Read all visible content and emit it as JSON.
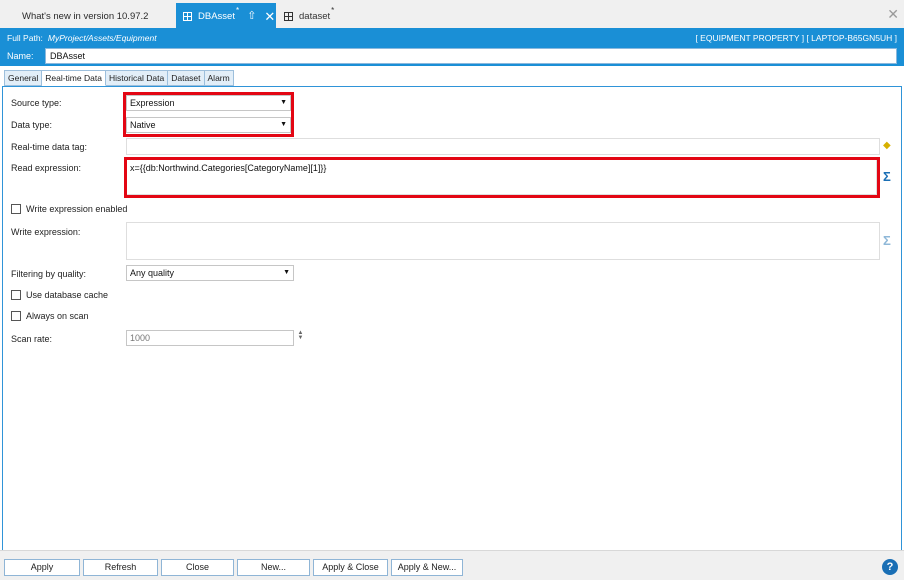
{
  "doc_tabs": [
    {
      "label": "What's new in version 10.97.2",
      "modified": ""
    },
    {
      "label": "DBAsset",
      "modified": "*"
    },
    {
      "label": "dataset",
      "modified": "*"
    }
  ],
  "header": {
    "path_label": "Full Path:",
    "path_value": "MyProject/Assets/Equipment",
    "path_right": "[ EQUIPMENT PROPERTY ] [ LAPTOP-B65GN5UH ]",
    "name_label": "Name:",
    "name_value": "DBAsset"
  },
  "property_tabs": [
    "General",
    "Real-time Data",
    "Historical Data",
    "Dataset",
    "Alarm"
  ],
  "form": {
    "source_type_label": "Source type:",
    "source_type_value": "Expression",
    "data_type_label": "Data type:",
    "data_type_value": "Native",
    "realtime_tag_label": "Real-time data tag:",
    "realtime_tag_value": "",
    "read_expression_label": "Read expression:",
    "read_expression_value": "x={{db:Northwind.Categories[CategoryName][1]}}",
    "write_enabled_label": "Write expression enabled",
    "write_expression_label": "Write expression:",
    "write_expression_value": "",
    "filtering_label": "Filtering by quality:",
    "filtering_value": "Any quality",
    "use_cache_label": "Use database cache",
    "always_scan_label": "Always on scan",
    "scan_rate_label": "Scan rate:",
    "scan_rate_value": "1000"
  },
  "buttons": {
    "apply": "Apply",
    "refresh": "Refresh",
    "close": "Close",
    "new": "New...",
    "apply_close": "Apply & Close",
    "apply_new": "Apply & New..."
  },
  "icons": {
    "sigma": "Σ",
    "help": "?",
    "tab_close": "✕",
    "pin": "⇧",
    "caret": "▼",
    "spin_up": "▲",
    "spin_down": "▼"
  },
  "colors": {
    "accent": "#1a8fd6",
    "highlight": "#e30613",
    "sigma_active": "#1a6fb5",
    "sigma_inactive": "#8fb8d8"
  }
}
